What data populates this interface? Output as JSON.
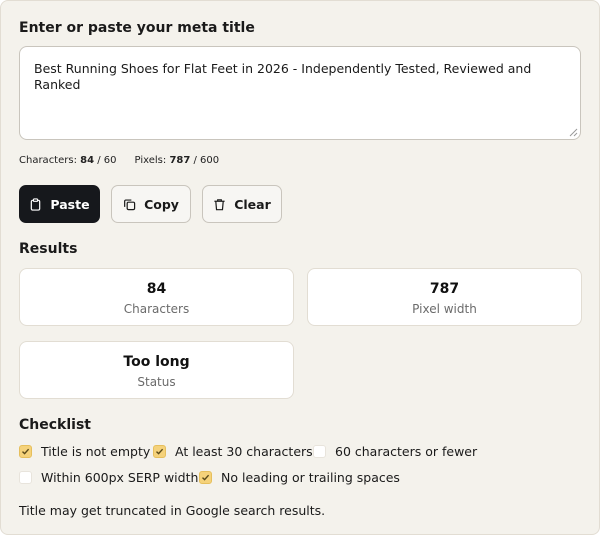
{
  "input": {
    "heading": "Enter or paste your meta title",
    "value": "Best Running Shoes for Flat Feet in 2026 - Independently Tested, Reviewed and Ranked"
  },
  "counts": {
    "chars_label": "Characters:",
    "chars_value": "84",
    "chars_limit": "/ 60",
    "pixels_label": "Pixels:",
    "pixels_value": "787",
    "pixels_limit": "/ 600"
  },
  "buttons": {
    "paste": "Paste",
    "copy": "Copy",
    "clear": "Clear"
  },
  "results": {
    "heading": "Results",
    "cards": [
      {
        "value": "84",
        "label": "Characters"
      },
      {
        "value": "787",
        "label": "Pixel width"
      },
      {
        "value": "Too long",
        "label": "Status"
      }
    ]
  },
  "checklist": {
    "heading": "Checklist",
    "items": [
      {
        "label": "Title is not empty",
        "checked": true
      },
      {
        "label": "At least 30 characters",
        "checked": true
      },
      {
        "label": "60 characters or fewer",
        "checked": false
      },
      {
        "label": "Within 600px SERP width",
        "checked": false
      },
      {
        "label": "No leading or trailing spaces",
        "checked": true
      }
    ]
  },
  "note": "Title may get truncated in Google search results.",
  "colors": {
    "panel_bg": "#f4f2ec",
    "primary_button": "#16181c",
    "check_fill": "#f5d27a"
  }
}
